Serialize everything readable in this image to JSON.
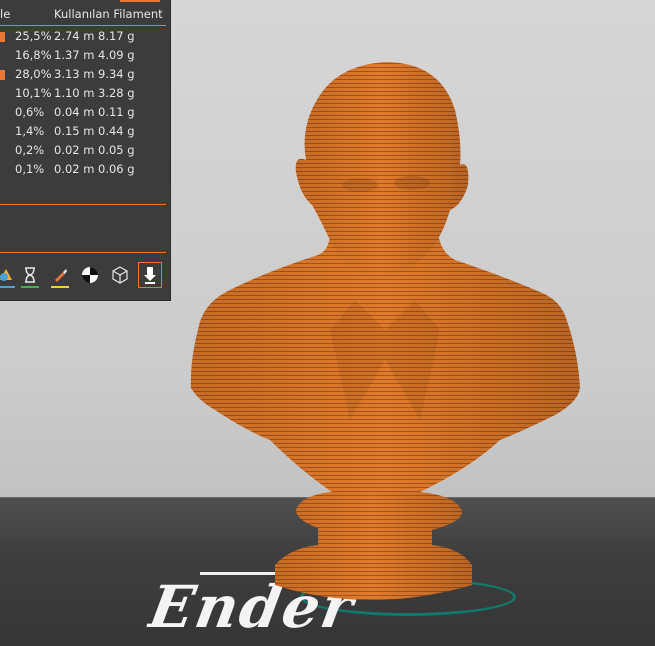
{
  "legend": {
    "col_partial": "le",
    "col_filament": "Kullanılan Filament",
    "rows": [
      {
        "percent": "25,5%",
        "length": "2.74 m",
        "weight": "8.17 g",
        "swatch": "#e8783a"
      },
      {
        "percent": "16,8%",
        "length": "1.37 m",
        "weight": "4.09 g",
        "swatch": null
      },
      {
        "percent": "28,0%",
        "length": "3.13 m",
        "weight": "9.34 g",
        "swatch": "#e8783a"
      },
      {
        "percent": "10,1%",
        "length": "1.10 m",
        "weight": "3.28 g",
        "swatch": null
      },
      {
        "percent": "0,6%",
        "length": "0.04 m",
        "weight": "0.11 g",
        "swatch": null
      },
      {
        "percent": "1,4%",
        "length": "0.15 m",
        "weight": "0.44 g",
        "swatch": null
      },
      {
        "percent": "0,2%",
        "length": "0.02 m",
        "weight": "0.05 g",
        "swatch": null
      },
      {
        "percent": "0,1%",
        "length": "0.02 m",
        "weight": "0.06 g",
        "swatch": null
      }
    ]
  },
  "toolbar": {
    "icons": [
      "color-scheme-icon",
      "hourglass-icon",
      "paint-brush-icon",
      "center-target-icon",
      "wireframe-cube-icon",
      "download-arrow-icon"
    ]
  },
  "bed": {
    "logo_text": "Ender"
  },
  "colors": {
    "accent": "#e8783a",
    "panel_bg": "#3c3c3c",
    "model": "#e07a2c"
  }
}
